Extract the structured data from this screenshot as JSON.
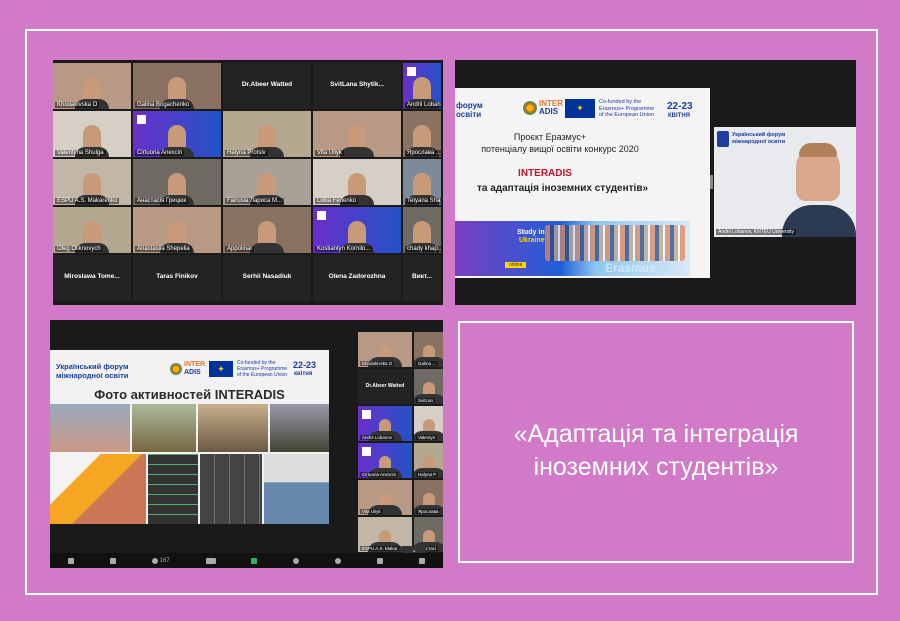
{
  "zoom_grid_top": {
    "tiles": [
      {
        "name": "Khodakivska O",
        "kind": "person"
      },
      {
        "name": "Galina Bogachenko",
        "kind": "person"
      },
      {
        "name": "Dr.Abeer Watted",
        "kind": "text"
      },
      {
        "name": "SvitLana  Shytik...",
        "kind": "text"
      },
      {
        "name": "Andrii Lobanov",
        "kind": "logo"
      },
      {
        "name": "Valentyna Shulga",
        "kind": "person"
      },
      {
        "name": "Cirtuoria Anexcin",
        "kind": "logo"
      },
      {
        "name": "Halyna Protsiv",
        "kind": "person"
      },
      {
        "name": "Vita Uliyk",
        "kind": "person"
      },
      {
        "name": "Ярослава ...",
        "kind": "person"
      },
      {
        "name": "ESPU A.S. Makarenko",
        "kind": "person"
      },
      {
        "name": "Анастасія Грицюк",
        "kind": "person"
      },
      {
        "name": "Fairusia Лариса М...",
        "kind": "person"
      },
      {
        "name": "Lidiia Fedenko",
        "kind": "person"
      },
      {
        "name": "Tetyana Sha...",
        "kind": "person"
      },
      {
        "name": "Oleg Oliknovych",
        "kind": "person"
      },
      {
        "name": "Anastasiia Shepelia",
        "kind": "person"
      },
      {
        "name": "Appolinar",
        "kind": "person"
      },
      {
        "name": "Kostiantyn Kornilo...",
        "kind": "logo"
      },
      {
        "name": "chady khap...",
        "kind": "person"
      },
      {
        "name": "Miroslawa  Tome...",
        "kind": "text"
      },
      {
        "name": "Taras Finikov",
        "kind": "text"
      },
      {
        "name": "Serhii Nasadiuk",
        "kind": "text"
      },
      {
        "name": "Olena Zadorozhna",
        "kind": "text"
      },
      {
        "name": "Викт...",
        "kind": "text"
      }
    ]
  },
  "slide_top": {
    "forum": "форум\nосвіти",
    "inter": "INTER",
    "adis": "ADIS",
    "cofund": "Co-funded by the\nErasmus+ Programme\nof the European Union",
    "date_num": "22-23",
    "date_month": "КВІТНЯ",
    "line1": "Проєкт Еразмус+",
    "line2": "потенціалу вищої освіти конкурс 2020",
    "line3": "INTERADIS",
    "line4": "та адаптація іноземних студентів»",
    "study1": "Study in",
    "study2": "Ukraine",
    "online": "online",
    "erasmus": "Erasmus"
  },
  "speaker": {
    "org": "Український форум\nміжнародної освіти",
    "name": "Andrii Lobanov, KNTEU University"
  },
  "slide_bottom": {
    "forum": "Український форум\nміжнародної освіти",
    "inter": "INTER",
    "adis": "ADIS",
    "cofund": "Co-funded by the\nErasmus+ Programme\nof the European Union",
    "date_num": "22-23",
    "date_month": "квітня",
    "title": "Фото активностей INTERADIS"
  },
  "side_grid": {
    "tiles": [
      {
        "name": "Khodakivska O"
      },
      {
        "name": "Galina ..."
      },
      {
        "name": "Dr.Abeer Watted"
      },
      {
        "name": "SvitLan"
      },
      {
        "name": "Andrii Lobanov"
      },
      {
        "name": "Valentyn"
      },
      {
        "name": "Cirtuoria Anexcin"
      },
      {
        "name": "Halyna P"
      },
      {
        "name": "Vita Uliyk"
      },
      {
        "name": "Ярослава"
      },
      {
        "name": "ESPU A.S. Makar..."
      },
      {
        "name": "Анастасі"
      }
    ]
  },
  "toolbar": {
    "count": "167"
  },
  "quote": "«Адаптація та інтеграція\nіноземних студентів»"
}
